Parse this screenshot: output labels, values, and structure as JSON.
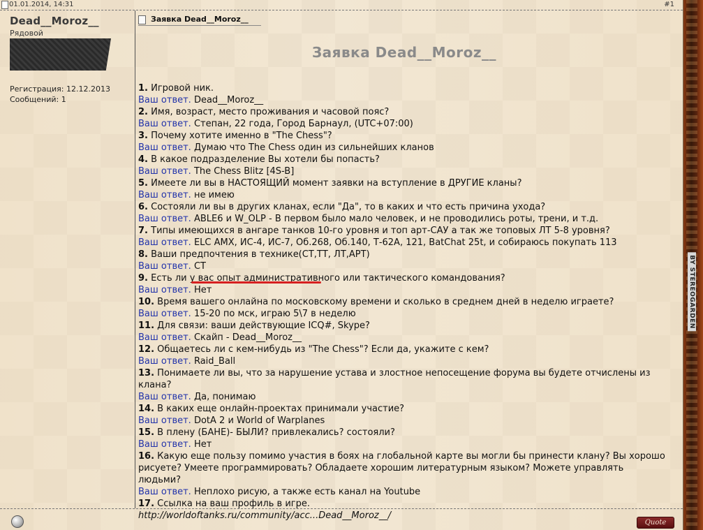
{
  "post": {
    "date": "01.01.2014, 14:31",
    "number": "#1",
    "topic_title": "Заявка Dead__Moroz__",
    "heading": "Заявка Dead__Moroz__"
  },
  "author": {
    "username": "Dead__Moroz__",
    "rank": "Рядовой",
    "registration": "Регистрация: 12.12.2013",
    "messages": "Сообщений: 1"
  },
  "answer_label": "Ваш ответ.",
  "qa": [
    {
      "num": "1.",
      "question": "Игровой ник.",
      "answer": "Dead__Moroz__"
    },
    {
      "num": "2.",
      "question": "Имя, возраст, место проживания и часовой пояс?",
      "answer": "Степан, 22 года, Город Барнаул, (UTC+07:00)"
    },
    {
      "num": "3.",
      "question": "Почему хотите именно в \"The Chess\"?",
      "answer": "Думаю что The Chess один из сильнейших кланов"
    },
    {
      "num": "4.",
      "question": "В какое подразделение Вы хотели бы попасть?",
      "answer": "The Chess Blitz [4S-B]"
    },
    {
      "num": "5.",
      "question": "Имеете ли вы в НАСТОЯЩИЙ момент заявки на вступление в ДРУГИЕ кланы?",
      "answer": "не имею"
    },
    {
      "num": "6.",
      "question": "Состояли ли вы в других кланах, если \"Да\", то в каких и что есть причина ухода?",
      "answer": "ABLE6 и W_OLP - В первом было мало человек, и не проводились роты, трени, и т.д."
    },
    {
      "num": "7.",
      "question": "Типы имеющихся в ангаре танков 10-го уровня и топ арт-САУ а так же топовых ЛТ 5-8 уровня?",
      "answer": "ELC AMX, ИС-4, ИС-7, Об.268, Об.140, Т-62А, 121, BatChat 25t, и собираюсь покупать 113"
    },
    {
      "num": "8.",
      "question": "Ваши предпочтения в технике(СТ,ТТ, ЛТ,АРТ)",
      "answer": "СТ"
    },
    {
      "num": "9.",
      "question": "Есть ли у вас опыт административного или тактического командования?",
      "answer": "Нет"
    },
    {
      "num": "10.",
      "question": "Время вашего онлайна по московскому времени и сколько в среднем дней в неделю играете?",
      "answer": "15-20 по мск, играю 5\\7 в неделю"
    },
    {
      "num": "11.",
      "question": "Для связи: ваши действующие ICQ#, Skype?",
      "answer": "Скайп - Dead__Moroz__"
    },
    {
      "num": "12.",
      "question": "Общаетесь ли с кем-нибудь из \"The Chess\"? Если да, укажите с кем?",
      "answer": "Raid_Ball"
    },
    {
      "num": "13.",
      "question": "Понимаете ли вы, что за нарушение устава и злостное непосещение форума вы будете отчислены из клана?",
      "answer": "Да, понимаю"
    },
    {
      "num": "14.",
      "question": "В каких еще онлайн-проектах принимали участие?",
      "answer": "DotA 2 и World of Warplanes"
    },
    {
      "num": "15.",
      "question": "В плену (БАНЕ)- БЫЛИ? привлекались? состояли?",
      "answer": "Нет"
    },
    {
      "num": "16.",
      "question": "Какую еще пользу помимо участия в боях на глобальной карте вы могли бы принести клану? Вы хорошо рисуете? Умеете программировать? Обладаете хорошим литературным языком? Можете управлять людьми?",
      "answer": "Неплохо рисую, а также есть канал на Youtube"
    },
    {
      "num": "17.",
      "question": "Ссылка на ваш профиль в игре.",
      "link": "http://worldoftanks.ru/community/acc...Dead__Moroz__/"
    }
  ],
  "footer": {
    "quote_label": "Quote"
  },
  "watermark": "BY STEREOGARDEN",
  "icons": {
    "post_doc": "document-icon",
    "topic_doc": "document-icon",
    "status": "status-orb-icon"
  },
  "colors": {
    "answer_label": "#2233aa",
    "underline_mark": "#d62020",
    "heading": "#8a8a8a"
  }
}
